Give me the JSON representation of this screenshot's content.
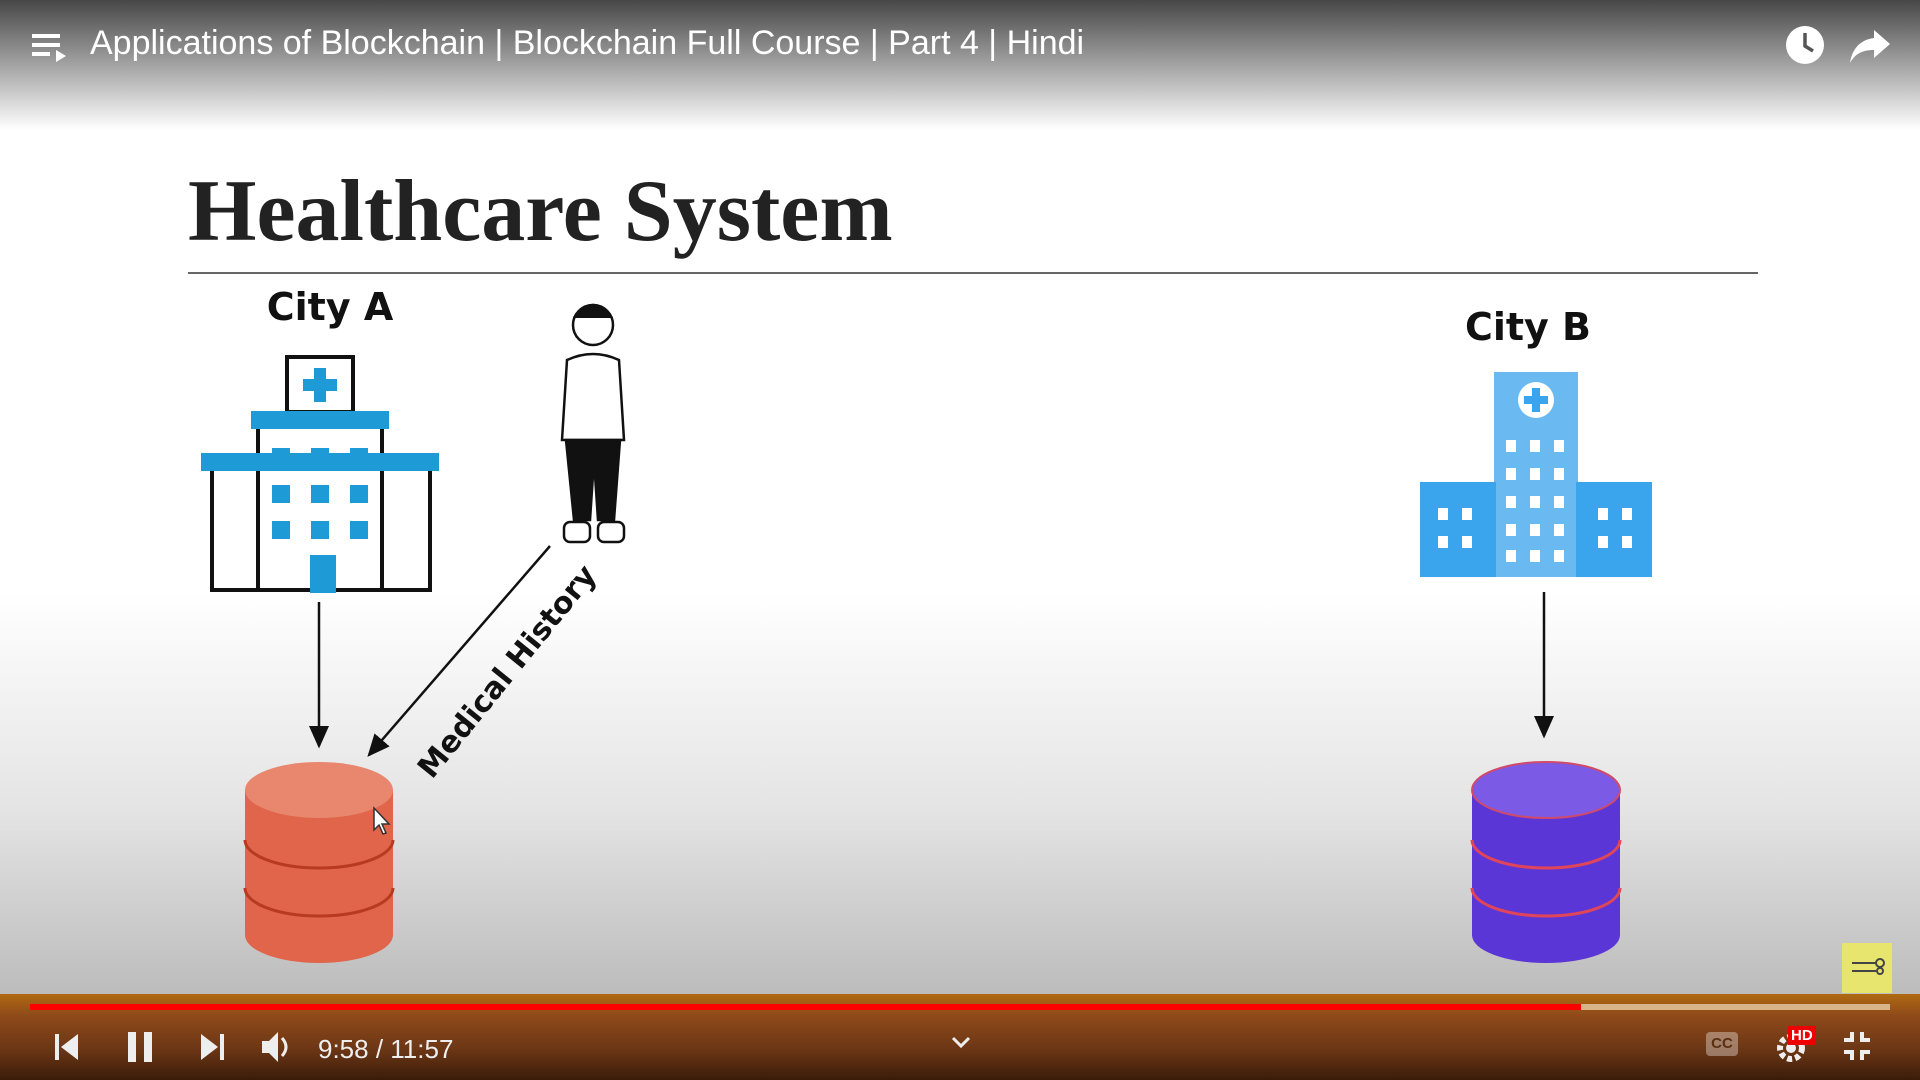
{
  "header": {
    "title": "Applications of Blockchain | Blockchain Full Course | Part 4 | Hindi",
    "icons": [
      "playlist-icon",
      "watch-later-icon",
      "share-icon"
    ]
  },
  "slide": {
    "heading": "Healthcare System",
    "city_a": "City A",
    "city_b": "City B",
    "arrow_label": "Medical History",
    "colors": {
      "hospital_a": "#1e9bd7",
      "hospital_b": "#3aa4ec",
      "db_a": "#e0654a",
      "db_b": "#5b36d6"
    }
  },
  "player": {
    "current_time": "9:58",
    "separator": " / ",
    "duration": "11:57",
    "played_fraction": 0.834,
    "buffered_fraction": 1.0,
    "hd_label": "HD",
    "cc_label": "CC",
    "progress_color": "#ff0000"
  }
}
